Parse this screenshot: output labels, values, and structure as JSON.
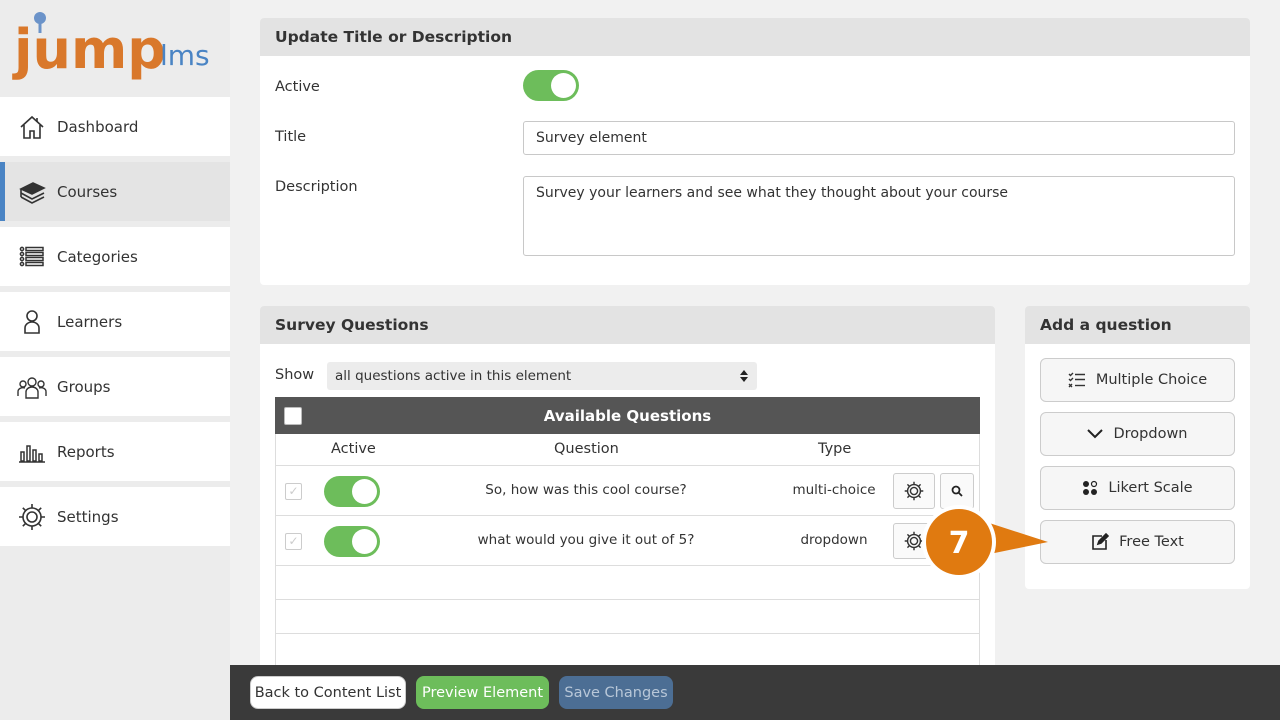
{
  "brand": {
    "logo_main": "jump",
    "logo_suffix": "lms",
    "colors": {
      "orange": "#d9782b",
      "blue": "#4a84c4",
      "gray": "#7c7f84"
    }
  },
  "sidebar": {
    "items": [
      {
        "label": "Dashboard",
        "icon": "home-icon"
      },
      {
        "label": "Courses",
        "icon": "books-icon",
        "active": true
      },
      {
        "label": "Categories",
        "icon": "list-icon"
      },
      {
        "label": "Learners",
        "icon": "person-icon"
      },
      {
        "label": "Groups",
        "icon": "group-icon"
      },
      {
        "label": "Reports",
        "icon": "bar-chart-icon"
      },
      {
        "label": "Settings",
        "icon": "gear-icon"
      }
    ]
  },
  "update_panel": {
    "title": "Update Title or Description",
    "active_label": "Active",
    "active": true,
    "title_label": "Title",
    "title_value": "Survey element",
    "description_label": "Description",
    "description_value": "Survey your learners and see what they thought about your course"
  },
  "survey_panel": {
    "title": "Survey Questions",
    "show_label": "Show",
    "show_selected": "all questions active in this element",
    "table_title": "Available Questions",
    "columns": [
      "Active",
      "Question",
      "Type"
    ],
    "rows": [
      {
        "active": true,
        "question": "So, how was this cool course?",
        "type": "multi-choice"
      },
      {
        "active": true,
        "question": "what would you give it out of 5?",
        "type": "dropdown"
      }
    ]
  },
  "add_panel": {
    "title": "Add a question",
    "buttons": [
      {
        "label": "Multiple Choice",
        "icon": "checklist-icon"
      },
      {
        "label": "Dropdown",
        "icon": "chevron-down-icon"
      },
      {
        "label": "Likert Scale",
        "icon": "dots-icon"
      },
      {
        "label": "Free Text",
        "icon": "edit-icon"
      }
    ]
  },
  "callout": {
    "number": "7",
    "color": "#e07a10"
  },
  "bottom_bar": {
    "back": "Back to Content List",
    "preview": "Preview Element",
    "save": "Save Changes"
  }
}
